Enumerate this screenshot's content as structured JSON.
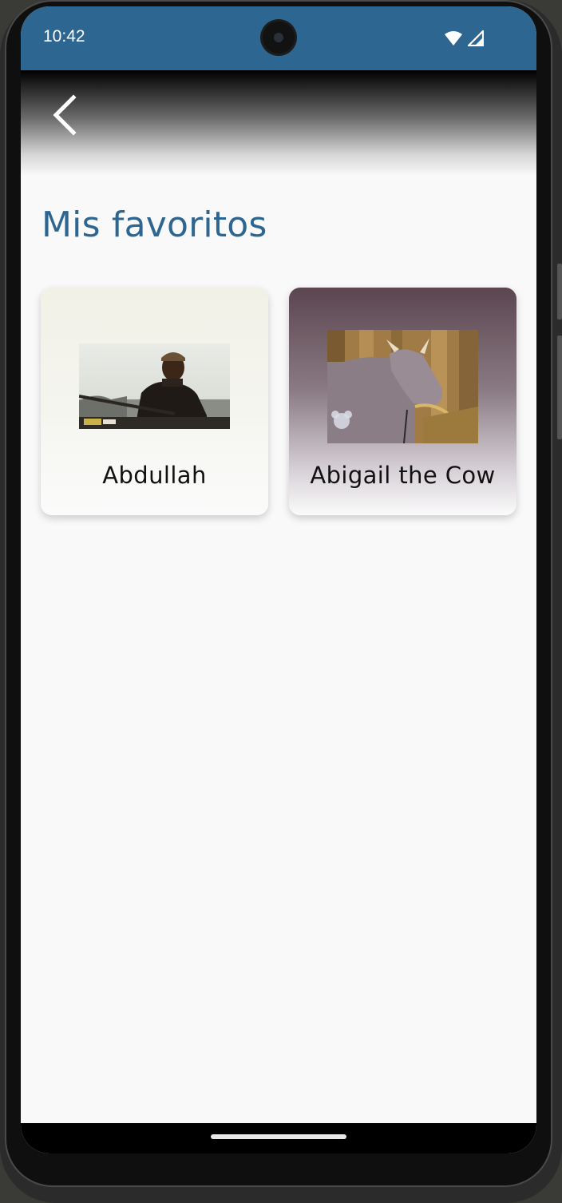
{
  "status_bar": {
    "time": "10:42",
    "wifi_icon": "wifi-icon",
    "signal_icon": "cellular-signal-icon"
  },
  "header": {
    "back_icon": "chevron-left-icon"
  },
  "page": {
    "title": "Mis favoritos"
  },
  "favorites": [
    {
      "name": "Abdullah",
      "image": "photo of a man in a dark jacket and cap"
    },
    {
      "name": "Abigail the Cow",
      "image": "cartoon cow in a barn eating hay"
    }
  ],
  "colors": {
    "status_bar": "#2d6690",
    "title": "#2d6690",
    "background": "#f9f9f9"
  }
}
